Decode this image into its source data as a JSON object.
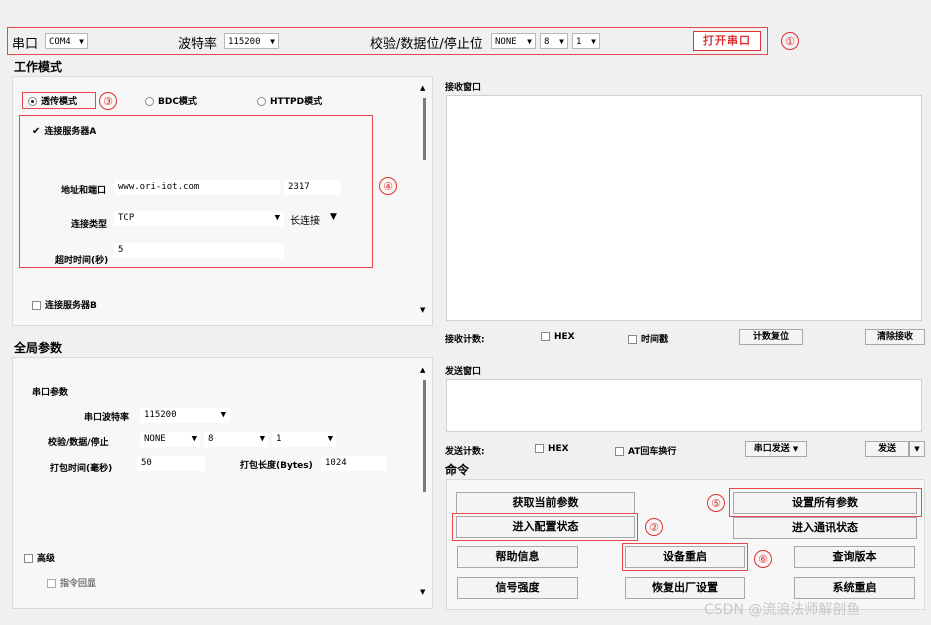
{
  "topbar": {
    "port_label": "串口",
    "port_value": "COM4",
    "baud_label": "波特率",
    "baud_value": "115200",
    "check_label": "校验/数据位/停止位",
    "parity_value": "NONE",
    "databits_value": "8",
    "stopbits_value": "1",
    "open_button": "打开串口"
  },
  "annotations": [
    "①",
    "②",
    "③",
    "④",
    "⑤",
    "⑥"
  ],
  "workmode": {
    "title": "工作模式",
    "modes": [
      "透传模式",
      "BDC模式",
      "HTTPD模式"
    ],
    "server_a_label": "连接服务器A",
    "addr_label": "地址和端口",
    "addr_value": "www.ori-iot.com",
    "port_value": "2317",
    "conn_type_label": "连接类型",
    "conn_type_value": "TCP",
    "conn_mode_value": "长连接",
    "timeout_label": "超时时间(秒)",
    "timeout_value": "5",
    "server_b_label": "连接服务器B"
  },
  "global": {
    "title": "全局参数",
    "serial_section": "串口参数",
    "baud_label": "串口波特率",
    "baud_value": "115200",
    "check_label": "校验/数据/停止",
    "parity_value": "NONE",
    "databits_value": "8",
    "stopbits_value": "1",
    "pack_time_label": "打包时间(毫秒)",
    "pack_time_value": "50",
    "pack_len_label": "打包长度(Bytes)",
    "pack_len_value": "1024",
    "advanced_label": "高级",
    "echo_label": "指令回显"
  },
  "receive": {
    "title": "接收窗口",
    "count_label": "接收计数:",
    "hex_label": "HEX",
    "timestamp_label": "时间戳",
    "reset_button": "计数复位",
    "clear_button": "清除接收"
  },
  "send": {
    "title": "发送窗口",
    "count_label": "发送计数:",
    "hex_label": "HEX",
    "crlf_label": "AT回车换行",
    "mode_value": "串口发送",
    "send_button": "发送"
  },
  "commands": {
    "title": "命令",
    "get_params": "获取当前参数",
    "set_all": "设置所有参数",
    "enter_config": "进入配置状态",
    "enter_comm": "进入通讯状态",
    "help": "帮助信息",
    "reboot": "设备重启",
    "version": "查询版本",
    "signal": "信号强度",
    "factory": "恢复出厂设置",
    "sys_reboot": "系统重启"
  },
  "watermark": "CSDN @流浪法师解剖鱼",
  "colors": {
    "annotation_red": "#e03030",
    "background": "#f0f0f0"
  }
}
